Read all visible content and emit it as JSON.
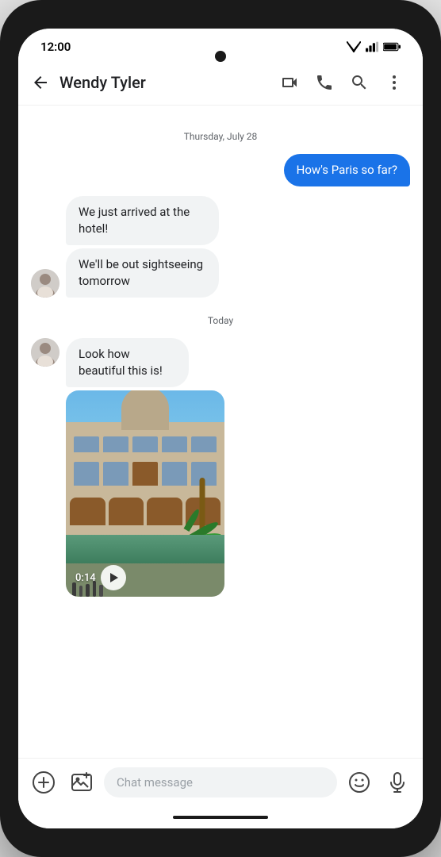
{
  "phone": {
    "status_bar": {
      "time": "12:00",
      "wifi_icon": "wifi",
      "signal_icon": "signal",
      "battery_icon": "battery"
    },
    "header": {
      "back_label": "←",
      "contact_name": "Wendy Tyler",
      "video_icon": "video-camera",
      "phone_icon": "phone",
      "search_icon": "search",
      "more_icon": "more-vertical"
    },
    "chat": {
      "date_divider_1": "Thursday, July 28",
      "date_divider_2": "Today",
      "messages": [
        {
          "id": "msg1",
          "type": "outgoing",
          "text": "How's Paris so far?"
        },
        {
          "id": "msg2",
          "type": "incoming",
          "text": "We just arrived at the hotel!"
        },
        {
          "id": "msg3",
          "type": "incoming",
          "text": "We'll be out sightseeing tomorrow"
        },
        {
          "id": "msg4",
          "type": "incoming",
          "text": "Look how beautiful this is!"
        },
        {
          "id": "msg5",
          "type": "incoming_media",
          "duration": "0:14"
        }
      ]
    },
    "bottom_bar": {
      "add_icon": "plus-circle",
      "media_icon": "image-plus",
      "input_placeholder": "Chat message",
      "emoji_icon": "emoji",
      "mic_icon": "microphone"
    }
  }
}
